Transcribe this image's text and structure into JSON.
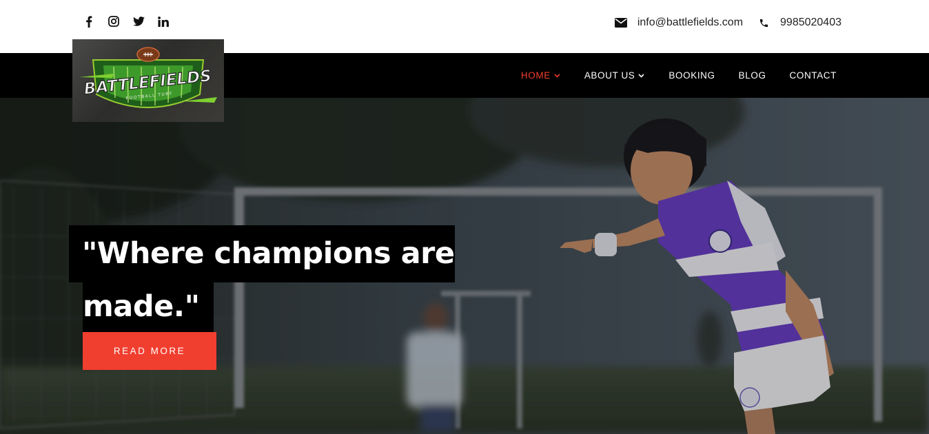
{
  "topbar": {
    "social": [
      {
        "icon": "facebook-icon"
      },
      {
        "icon": "instagram-icon"
      },
      {
        "icon": "twitter-icon"
      },
      {
        "icon": "linkedin-icon"
      }
    ],
    "email": "info@battlefields.com",
    "phone": "9985020403"
  },
  "logo": {
    "text": "BATTLEFIELDS",
    "subtext": "FOOTBALL TURF"
  },
  "nav": {
    "items": [
      {
        "label": "HOME",
        "active": true,
        "dropdown": true
      },
      {
        "label": "ABOUT US",
        "active": false,
        "dropdown": true
      },
      {
        "label": "BOOKING",
        "active": false,
        "dropdown": false
      },
      {
        "label": "BLOG",
        "active": false,
        "dropdown": false
      },
      {
        "label": "CONTACT",
        "active": false,
        "dropdown": false
      }
    ]
  },
  "hero": {
    "headline_line1": "\"Where champions are",
    "headline_line2": "made.\"",
    "cta_label": "READ MORE"
  },
  "colors": {
    "accent": "#f03e2f",
    "nav_bg": "#000000",
    "jersey": "#6a3fc6"
  }
}
